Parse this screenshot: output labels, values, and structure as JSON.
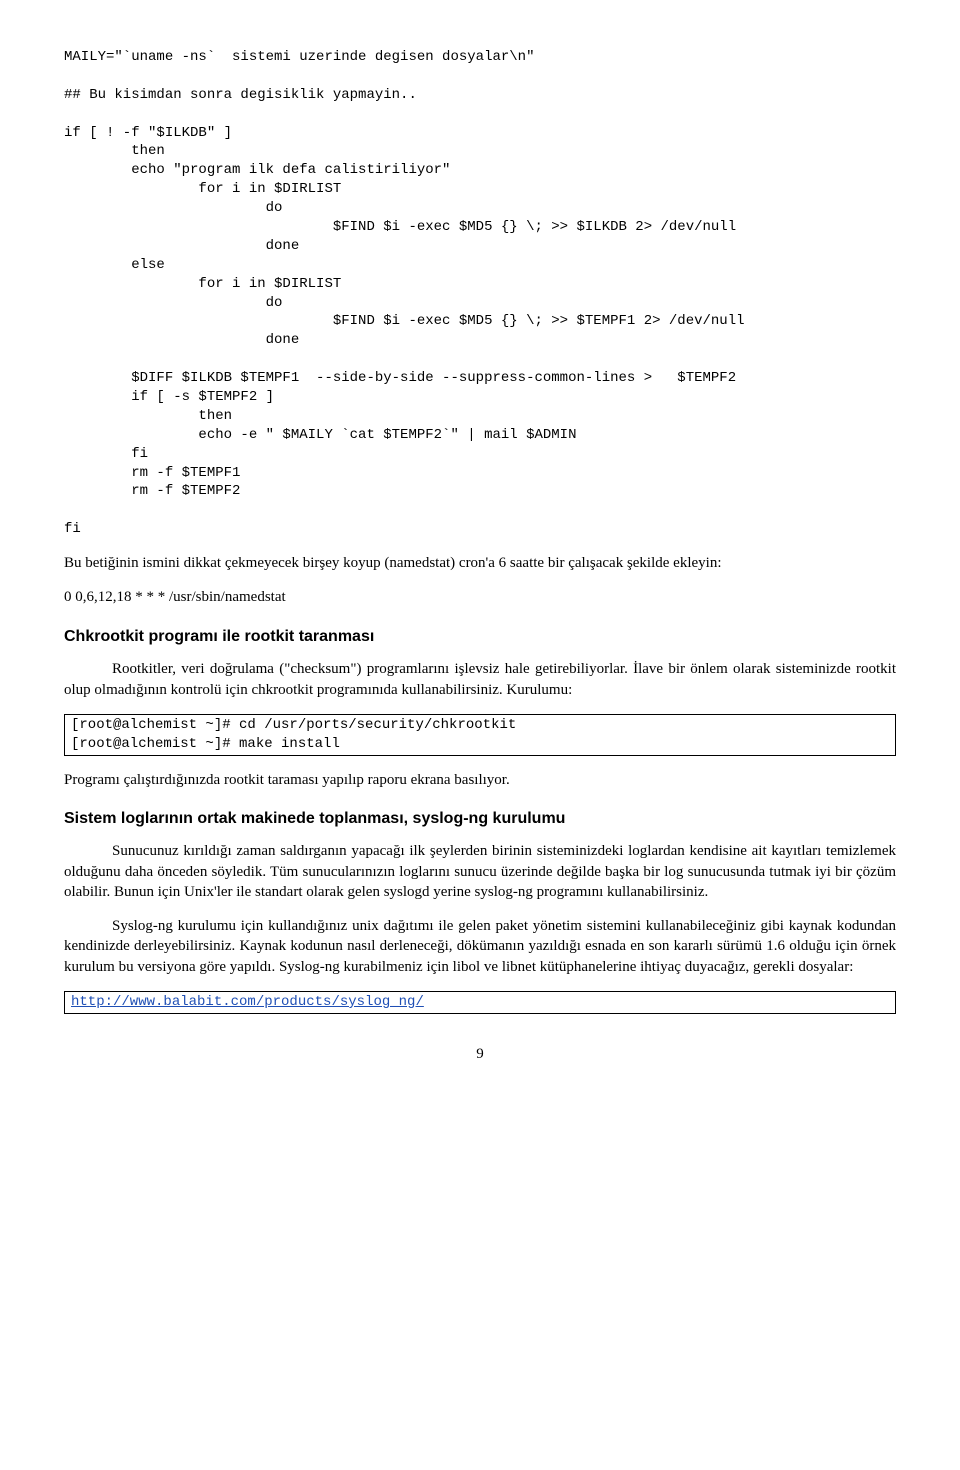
{
  "code1": "MAILY=\"`uname -ns`  sistemi uzerinde degisen dosyalar\\n\"\n\n## Bu kisimdan sonra degisiklik yapmayin..\n\nif [ ! -f \"$ILKDB\" ]\n        then\n        echo \"program ilk defa calistiriliyor\"\n                for i in $DIRLIST\n                        do\n                                $FIND $i -exec $MD5 {} \\; >> $ILKDB 2> /dev/null\n                        done\n        else\n                for i in $DIRLIST\n                        do\n                                $FIND $i -exec $MD5 {} \\; >> $TEMPF1 2> /dev/null\n                        done\n\n        $DIFF $ILKDB $TEMPF1  --side-by-side --suppress-common-lines >   $TEMPF2\n        if [ -s $TEMPF2 ]\n                then\n                echo -e \" $MAILY `cat $TEMPF2`\" | mail $ADMIN\n        fi\n        rm -f $TEMPF1\n        rm -f $TEMPF2\n\nfi",
  "para1": "Bu betiğinin ismini dikkat çekmeyecek birşey  koyup (namedstat) cron'a 6 saatte bir çalışacak şekilde ekleyin:",
  "cron": "0 0,6,12,18 * * * /usr/sbin/namedstat",
  "h1": "Chkrootkit programı ile rootkit taranması",
  "para2": "Rootkitler, veri doğrulama (\"checksum\") programlarını işlevsiz hale getirebiliyorlar. İlave bir önlem olarak sisteminizde rootkit olup olmadığının kontrolü için chkrootkit programınıda kullanabilirsiniz. Kurulumu:",
  "box1": "[root@alchemist ~]# cd /usr/ports/security/chkrootkit\n[root@alchemist ~]# make install",
  "para3": "Programı çalıştırdığınızda rootkit taraması yapılıp raporu ekrana basılıyor.",
  "h2": "Sistem loglarının ortak makinede toplanması, syslog-ng kurulumu",
  "para4": "Sunucunuz kırıldığı zaman saldırganın yapacağı ilk şeylerden birinin sisteminizdeki loglardan kendisine ait kayıtları temizlemek olduğunu daha önceden söyledik. Tüm sunucularınızın loglarını sunucu üzerinde değilde başka bir log sunucusunda tutmak iyi bir çözüm olabilir. Bunun için Unix'ler ile standart olarak gelen syslogd yerine  syslog-ng programını kullanabilirsiniz.",
  "para5": "Syslog-ng kurulumu için kullandığınız unix dağıtımı ile gelen paket yönetim sistemini kullanabileceğiniz gibi kaynak kodundan kendinizde derleyebilirsiniz. Kaynak kodunun nasıl derleneceği, dökümanın yazıldığı esnada en son kararlı sürümü 1.6 olduğu için örnek kurulum bu versiyona göre yapıldı. Syslog-ng kurabilmeniz için libol ve libnet kütüphanelerine ihtiyaç duyacağız, gerekli dosyalar:",
  "link": "http://www.balabit.com/products/syslog_ng/",
  "pagenum": "9"
}
